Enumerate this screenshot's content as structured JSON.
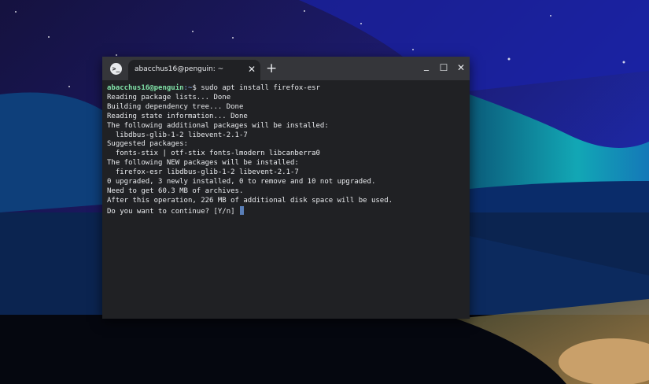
{
  "terminal": {
    "tab_title": "abacchus16@penguin: ~",
    "icon": "terminal-icon",
    "prompt_user": "abacchus16@penguin",
    "prompt_path": ":~",
    "prompt_symbol": "$ ",
    "command": "sudo apt install firefox-esr",
    "output": [
      "Reading package lists... Done",
      "Building dependency tree... Done",
      "Reading state information... Done",
      "The following additional packages will be installed:",
      "  libdbus-glib-1-2 libevent-2.1-7",
      "Suggested packages:",
      "  fonts-stix | otf-stix fonts-lmodern libcanberra0",
      "The following NEW packages will be installed:",
      "  firefox-esr libdbus-glib-1-2 libevent-2.1-7",
      "0 upgraded, 3 newly installed, 0 to remove and 10 not upgraded.",
      "Need to get 60.3 MB of archives.",
      "After this operation, 226 MB of additional disk space will be used.",
      "Do you want to continue? [Y/n] "
    ]
  },
  "controls": {
    "close_tab": "✕",
    "new_tab": "+",
    "minimize": "_",
    "maximize": "☐",
    "close": "✕"
  },
  "colors": {
    "prompt_user": "#80e1a7",
    "background": "#202124",
    "cursor": "#5a7fb8"
  }
}
